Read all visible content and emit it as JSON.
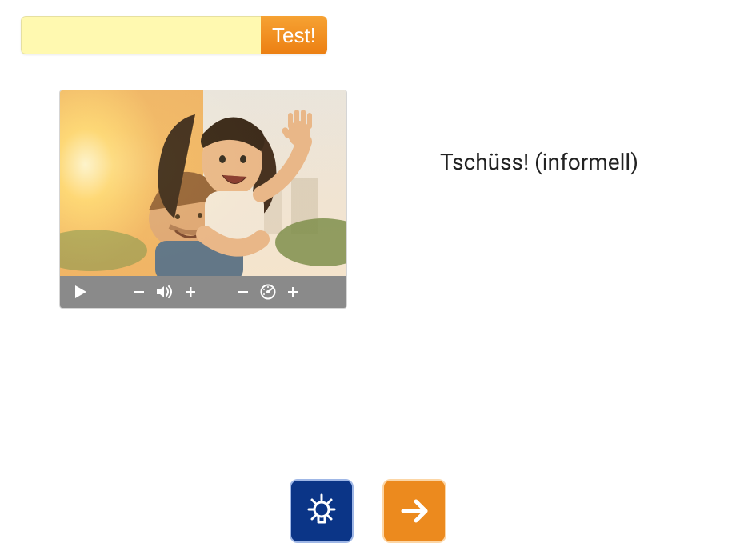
{
  "input": {
    "value": "",
    "placeholder": ""
  },
  "test_button": {
    "label": "Test!"
  },
  "prompt": {
    "text": "Tschüss! (informell)"
  },
  "controls": {
    "play": "play-icon",
    "vol_minus": "minus-icon",
    "volume": "volume-icon",
    "vol_plus": "plus-icon",
    "speed_minus": "minus-icon",
    "speed": "gauge-icon",
    "speed_plus": "plus-icon"
  },
  "bottom": {
    "hint": "lightbulb-icon",
    "next": "arrow-right-icon"
  },
  "image_alt": "Two people smiling and waving outdoors"
}
